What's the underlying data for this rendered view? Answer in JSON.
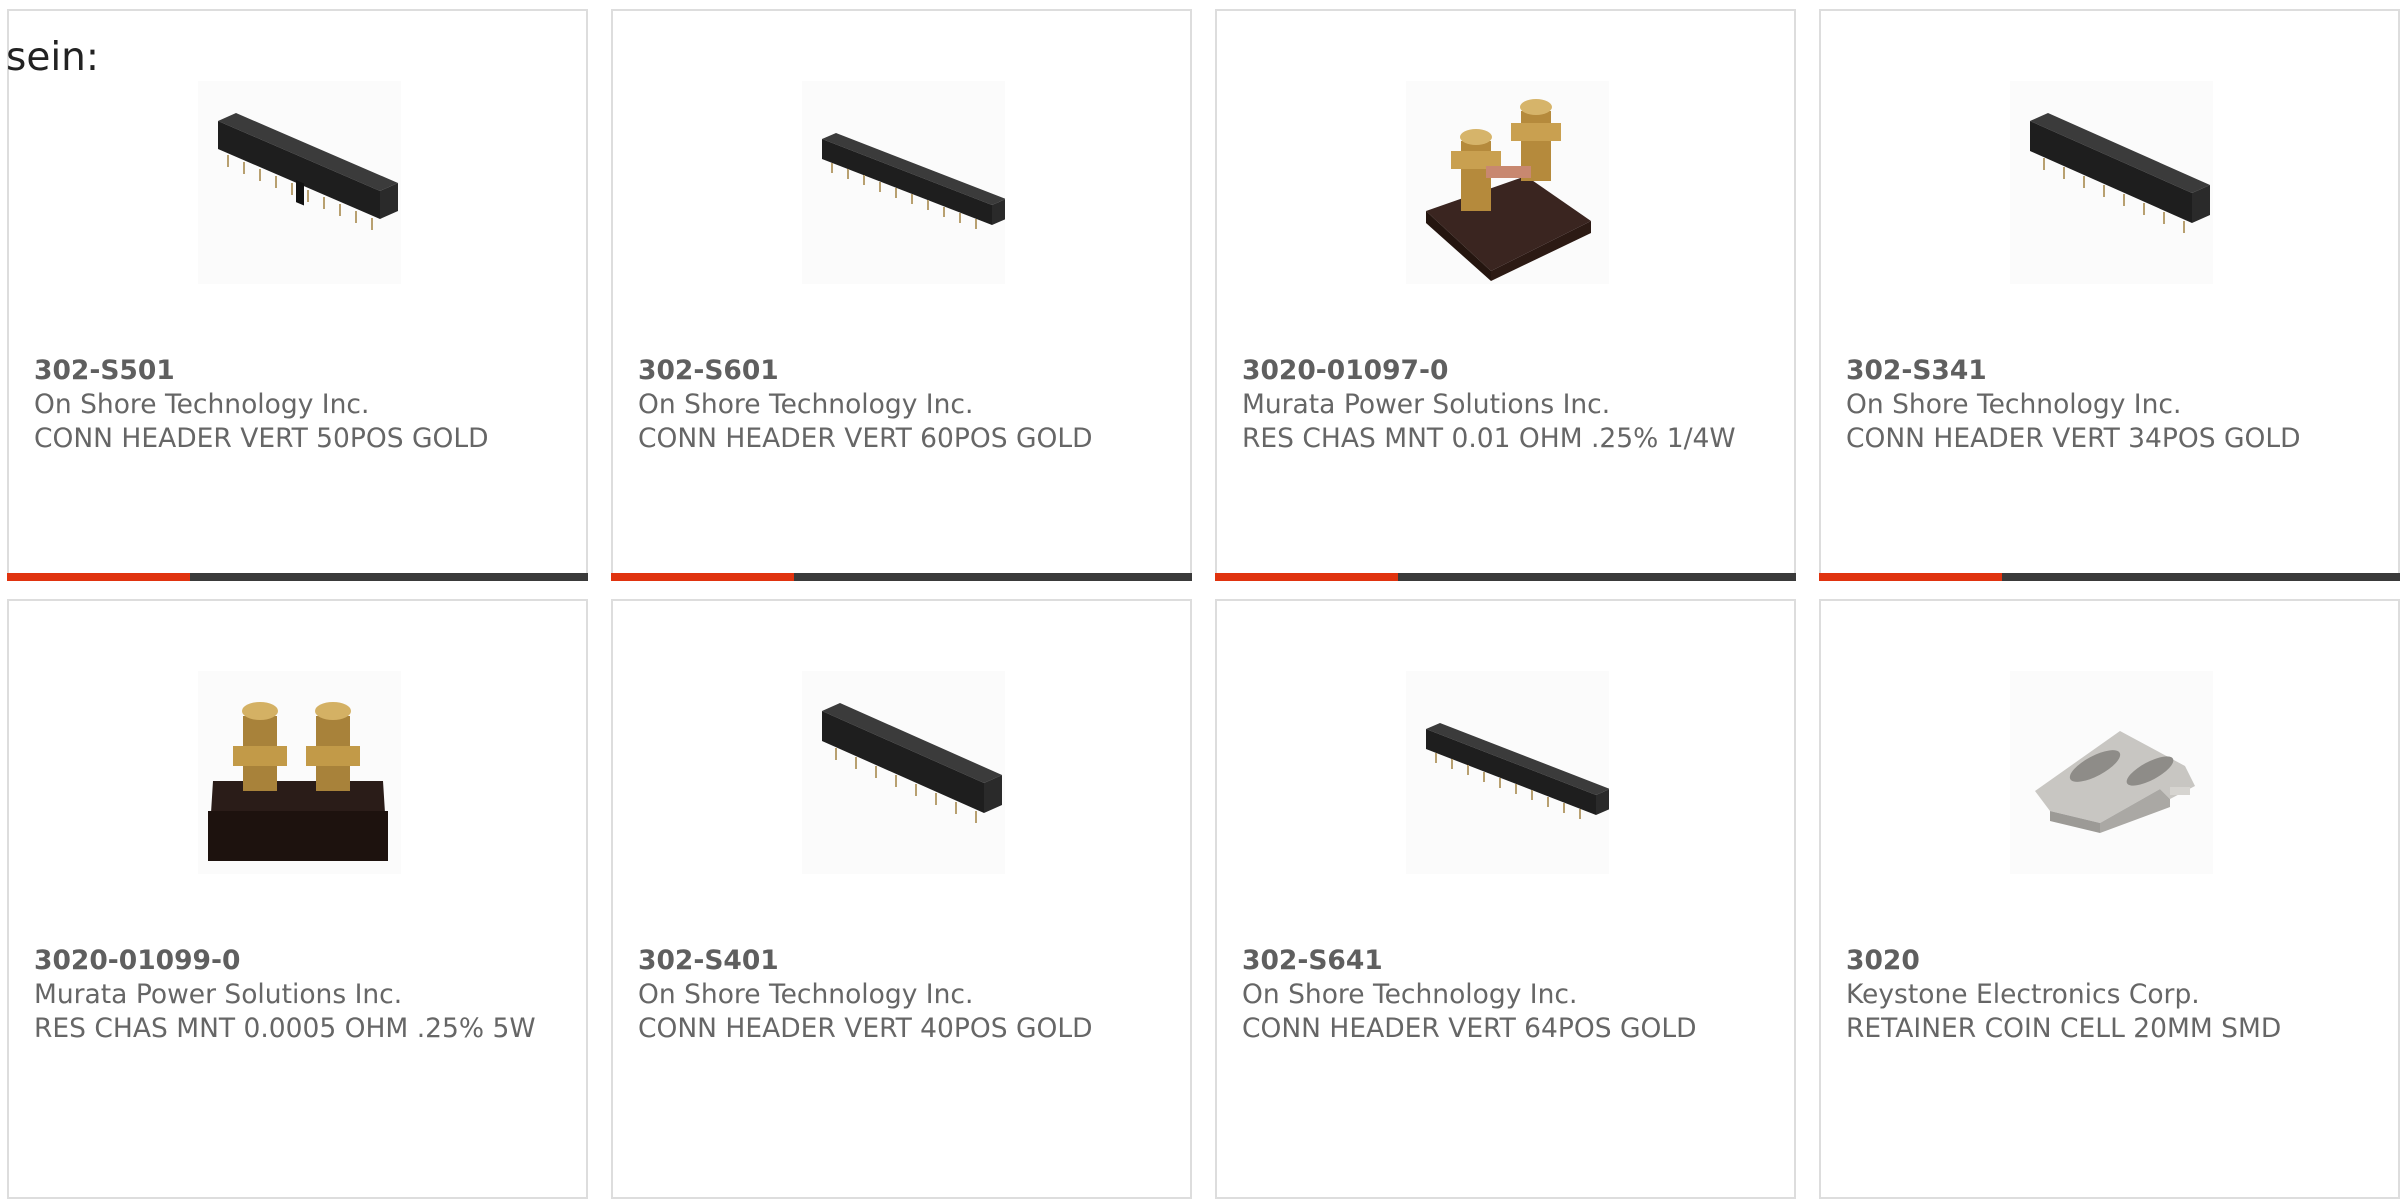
{
  "intro_text": "sein:",
  "products": [
    {
      "part_number": "302-S501",
      "manufacturer": "On Shore Technology Inc.",
      "description": "CONN HEADER VERT 50POS GOLD",
      "image": "header-connector-icon"
    },
    {
      "part_number": "302-S601",
      "manufacturer": "On Shore Technology Inc.",
      "description": "CONN HEADER VERT 60POS GOLD",
      "image": "header-connector-icon"
    },
    {
      "part_number": "3020-01097-0",
      "manufacturer": "Murata Power Solutions Inc.",
      "description": "RES CHAS MNT 0.01 OHM .25% 1/4W",
      "image": "shunt-resistor-icon"
    },
    {
      "part_number": "302-S341",
      "manufacturer": "On Shore Technology Inc.",
      "description": "CONN HEADER VERT 34POS GOLD",
      "image": "header-connector-icon"
    },
    {
      "part_number": "3020-01099-0",
      "manufacturer": "Murata Power Solutions Inc.",
      "description": "RES CHAS MNT 0.0005 OHM .25% 5W",
      "image": "shunt-resistor-icon"
    },
    {
      "part_number": "302-S401",
      "manufacturer": "On Shore Technology Inc.",
      "description": "CONN HEADER VERT 40POS GOLD",
      "image": "header-connector-icon"
    },
    {
      "part_number": "302-S641",
      "manufacturer": "On Shore Technology Inc.",
      "description": "CONN HEADER VERT 64POS GOLD",
      "image": "header-connector-icon"
    },
    {
      "part_number": "3020",
      "manufacturer": "Keystone Electronics Corp.",
      "description": "RETAINER COIN CELL 20MM SMD",
      "image": "coin-cell-retainer-icon"
    }
  ],
  "colors": {
    "accent": "#e0330f",
    "bar": "#3a3a3a",
    "border": "#dddddd",
    "text": "#666666"
  }
}
